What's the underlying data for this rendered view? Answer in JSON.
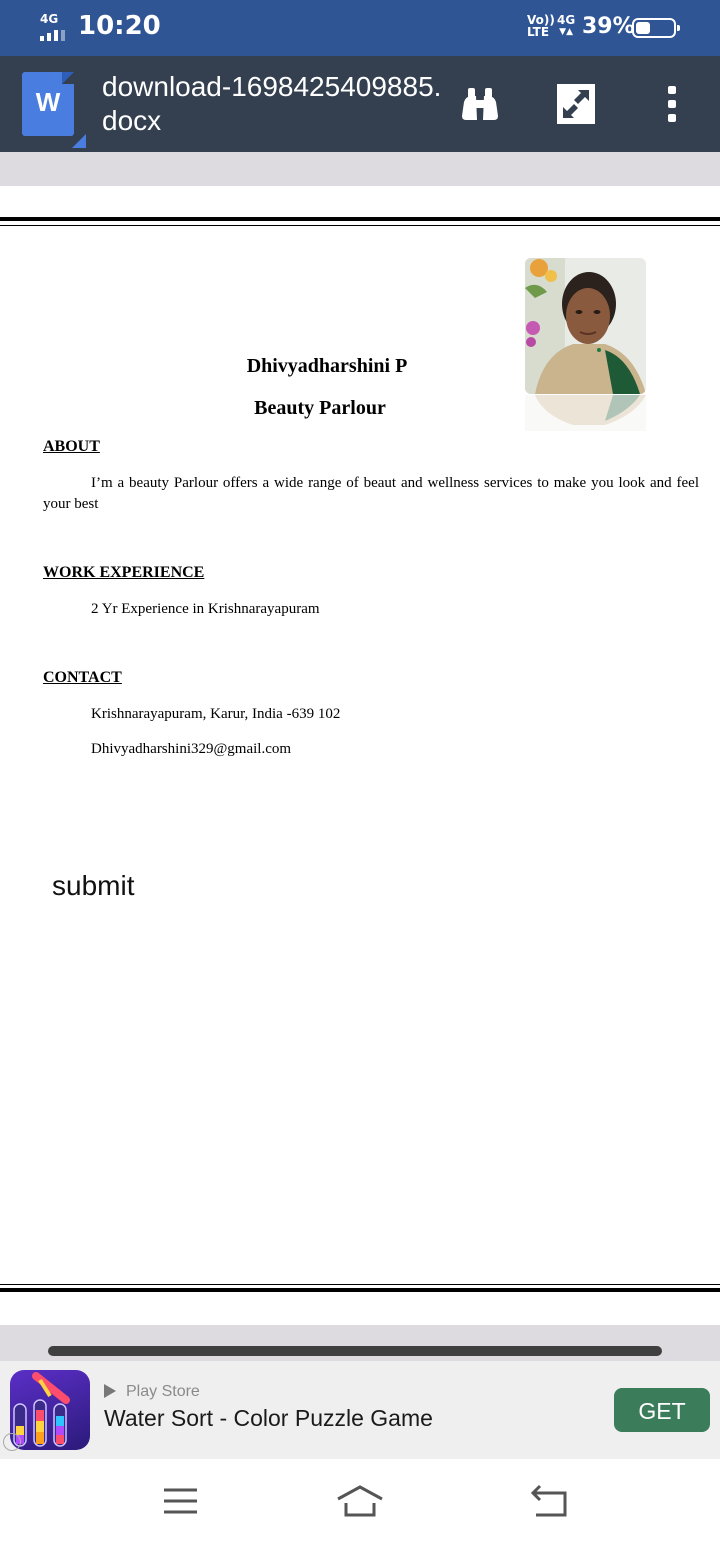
{
  "status_bar": {
    "network": "4G",
    "time": "10:20",
    "volte_top": "Vo))",
    "volte_bottom": "LTE",
    "network2": "4G",
    "battery_percent": "39%",
    "battery_level": 0.39
  },
  "app_bar": {
    "file_name": "download-1698425409885.docx",
    "doc_icon_letter": "W",
    "icons": [
      "binoculars-icon",
      "expand-icon",
      "more-vertical-icon"
    ]
  },
  "document": {
    "name": "Dhivyadharshini P",
    "role": "Beauty Parlour",
    "about_heading": "ABOUT",
    "about_text": "I’m a beauty Parlour offers a wide range of beaut and wellness services to make you look and feel your best",
    "work_heading": "WORK EXPERIENCE",
    "work_text": "2 Yr Experience in Krishnarayapuram",
    "contact_heading": "CONTACT",
    "address": "Krishnarayapuram, Karur, India -639 102",
    "email": "Dhivyadharshini329@gmail.com",
    "submit_text": "submit"
  },
  "ad": {
    "store": "Play Store",
    "title": "Water Sort - Color Puzzle Game",
    "cta": "GET"
  },
  "nav_bar": {
    "icons": [
      "menu-icon",
      "home-icon",
      "back-icon"
    ]
  },
  "colors": {
    "status_bar": "#2f5595",
    "app_bar": "#344050",
    "doc_icon": "#4a7de0",
    "get_button": "#3b7d5b"
  }
}
